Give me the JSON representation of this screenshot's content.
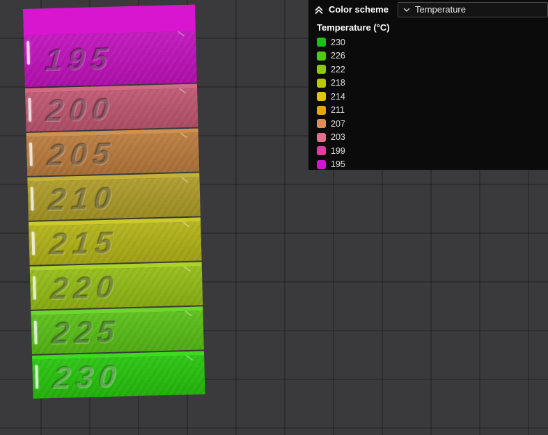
{
  "viewport": {
    "background": "#3a3a3c",
    "grid_line": "#2e2e30"
  },
  "legend": {
    "header": "Color scheme",
    "scheme_selected": "Temperature",
    "subtitle": "Temperature (°C)",
    "panel_bg": "#0b0b0b",
    "items": [
      {
        "value": "230",
        "color": "#17c115"
      },
      {
        "value": "226",
        "color": "#4fcb12"
      },
      {
        "value": "222",
        "color": "#8fc90e"
      },
      {
        "value": "218",
        "color": "#b9c906"
      },
      {
        "value": "214",
        "color": "#e0c703"
      },
      {
        "value": "211",
        "color": "#e5a50c"
      },
      {
        "value": "207",
        "color": "#e28b57"
      },
      {
        "value": "203",
        "color": "#e0718f"
      },
      {
        "value": "199",
        "color": "#e53aa2"
      },
      {
        "value": "195",
        "color": "#d313d6"
      }
    ]
  },
  "tower": {
    "blocks": [
      {
        "label": "195",
        "color": "#bf12ba",
        "top": "#d816cf"
      },
      {
        "label": "200",
        "color": "#bd5570",
        "top": "#d36a82"
      },
      {
        "label": "205",
        "color": "#b87a3c",
        "top": "#cf9150"
      },
      {
        "label": "210",
        "color": "#ac9a28",
        "top": "#c3b138"
      },
      {
        "label": "215",
        "color": "#b1b117",
        "top": "#cbca28"
      },
      {
        "label": "220",
        "color": "#93ba15",
        "top": "#abd426"
      },
      {
        "label": "225",
        "color": "#58bd17",
        "top": "#6fd62b"
      },
      {
        "label": "230",
        "color": "#27c20d",
        "top": "#3cdb1f"
      }
    ]
  }
}
